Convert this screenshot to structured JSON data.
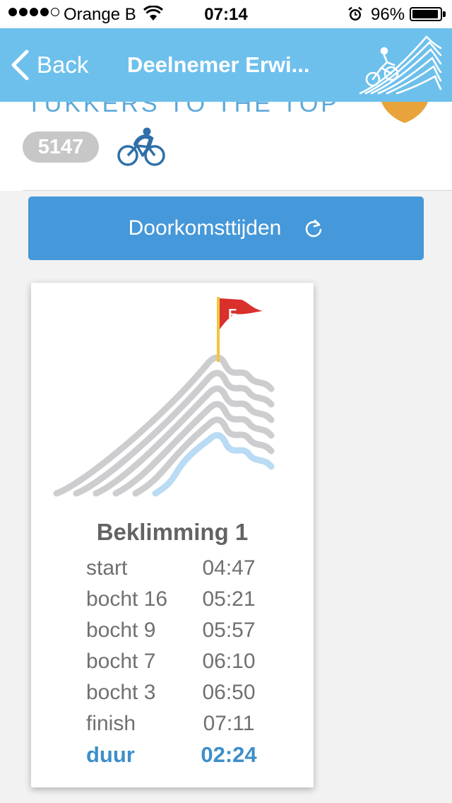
{
  "status_bar": {
    "carrier": "Orange B",
    "time": "07:14",
    "battery_percent": "96%",
    "battery_level": 0.96,
    "signal_bars": 4,
    "icons": [
      "signal-dots",
      "wifi-icon",
      "alarm-icon",
      "battery-icon"
    ]
  },
  "nav": {
    "back_label": "Back",
    "title": "Deelnemer Erwi...",
    "logo": "climbing-cyclist-mountain-logo"
  },
  "participant": {
    "team_name": "TUKKERS TO THE TOP",
    "bib_number": "5147",
    "discipline_icon": "cyclist-icon",
    "team_shield_color": "#e8a33b"
  },
  "refresh_button": {
    "label": "Doorkomsttijden",
    "icon": "refresh-icon"
  },
  "climb": {
    "title": "Beklimming 1",
    "flag_letter": "F",
    "times": [
      {
        "label": "start",
        "time": "04:47"
      },
      {
        "label": "bocht 16",
        "time": "05:21"
      },
      {
        "label": "bocht 9",
        "time": "05:57"
      },
      {
        "label": "bocht 7",
        "time": "06:10"
      },
      {
        "label": "bocht 3",
        "time": "06:50"
      },
      {
        "label": "finish",
        "time": "07:11"
      }
    ],
    "total": {
      "label": "duur",
      "time": "02:24"
    },
    "progress_layers_completed": 1,
    "progress_layers_total": 6
  },
  "colors": {
    "nav_background": "#6dc0ec",
    "button_blue": "#4598d9",
    "accent_blue": "#3d8fca",
    "flag_red": "#d9302c",
    "mountain_grey": "#cdcdd0",
    "mountain_progress": "#b9dbf3"
  }
}
